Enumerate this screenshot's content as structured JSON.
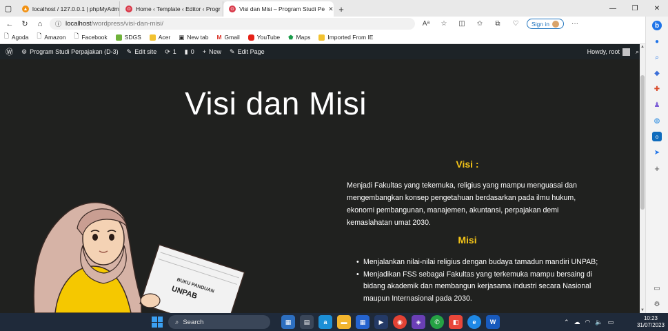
{
  "browser": {
    "tabs": [
      {
        "label": "localhost / 127.0.0.1 | phpMyAdm",
        "favicon": "phpmyadmin-icon",
        "active": false
      },
      {
        "label": "Home ‹ Template ‹ Editor ‹ Progr",
        "favicon": "wordpress-icon",
        "active": false
      },
      {
        "label": "Visi dan Misi – Program Studi Pe",
        "favicon": "wordpress-icon",
        "active": true
      }
    ],
    "address": {
      "host": "localhost",
      "path": "/wordpress/visi-dan-misi/"
    },
    "sign_in_label": "Sign in",
    "bookmarks": [
      "Agoda",
      "Amazon",
      "Facebook",
      "SDGS",
      "Acer",
      "New tab",
      "Gmail",
      "YouTube",
      "Maps",
      "Imported From IE"
    ]
  },
  "admin_bar": {
    "site_name": "Program Studi Perpajakan (D-3)",
    "edit_site": "Edit site",
    "updates_count": "1",
    "comments_count": "0",
    "new_label": "New",
    "edit_page": "Edit Page",
    "greeting": "Howdy, root"
  },
  "page": {
    "title": "Visi dan Misi",
    "visi_heading": "Visi :",
    "visi_text": "Menjadi Fakultas yang tekemuka, religius yang mampu menguasai dan mengembangkan konsep pengetahuan berdasarkan pada ilmu hukum, ekonomi pembangunan, manajemen, akuntansi, perpajakan demi kemaslahatan umat 2030.",
    "misi_heading": "Misi",
    "misi_items": [
      "Menjalankan nilai-nilai religius dengan budaya tamadun mandiri UNPAB;",
      "Menjadikan FSS sebagai Fakultas yang terkemuka mampu bersaing di bidang akademik dan membangun kerjasama industri secara Nasional maupun Internasional pada 2030."
    ],
    "book_text": "UNPAB",
    "book_small_text": "BUKU PANDUAN"
  },
  "taskbar": {
    "search_placeholder": "Search",
    "clock_time": "10:23",
    "clock_date": "31/07/2023"
  },
  "colors": {
    "page_bg": "#20211f",
    "heading_accent": "#f5c518",
    "admin_bar": "#1d2327",
    "taskbar": "#1f2a3a"
  }
}
